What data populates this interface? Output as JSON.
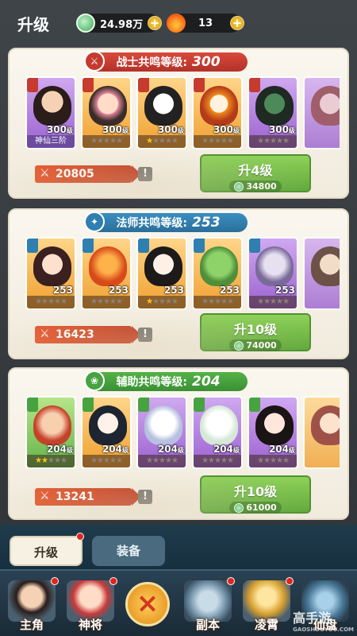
{
  "header": {
    "title": "升级"
  },
  "resources": {
    "coins": "24.98万",
    "fire": "13",
    "plus": "+"
  },
  "sections": [
    {
      "banner_label": "战士共鸣等级:",
      "banner_value": "300",
      "power": "20805",
      "button_label": "升4级",
      "button_cost": "34800",
      "cards": [
        {
          "level": "300",
          "unit": "级",
          "stars": 0,
          "name": "神仙三阶"
        },
        {
          "level": "300",
          "unit": "级",
          "stars": 0
        },
        {
          "level": "300",
          "unit": "级",
          "stars": 1
        },
        {
          "level": "300",
          "unit": "级",
          "stars": 0
        },
        {
          "level": "300",
          "unit": "级",
          "stars": 0
        }
      ]
    },
    {
      "banner_label": "法师共鸣等级:",
      "banner_value": "253",
      "power": "16423",
      "button_label": "升10级",
      "button_cost": "74000",
      "cards": [
        {
          "level": "253",
          "unit": "",
          "stars": 0
        },
        {
          "level": "253",
          "unit": "",
          "stars": 0
        },
        {
          "level": "253",
          "unit": "",
          "stars": 1
        },
        {
          "level": "253",
          "unit": "",
          "stars": 0
        },
        {
          "level": "253",
          "unit": "",
          "stars": 0
        }
      ]
    },
    {
      "banner_label": "辅助共鸣等级:",
      "banner_value": "204",
      "power": "13241",
      "button_label": "升10级",
      "button_cost": "61000",
      "cards": [
        {
          "level": "204",
          "unit": "级",
          "stars": 2
        },
        {
          "level": "204",
          "unit": "级",
          "stars": 0
        },
        {
          "level": "204",
          "unit": "级",
          "stars": 0
        },
        {
          "level": "204",
          "unit": "级",
          "stars": 0
        },
        {
          "level": "204",
          "unit": "级",
          "stars": 0
        }
      ]
    }
  ],
  "tabs": {
    "upgrade": "升级",
    "equip": "装备"
  },
  "nav": {
    "hero": "主角",
    "general": "神将",
    "close": "×",
    "dungeon": "副本",
    "lingxiao": "凌霄",
    "xianpan": "仙盘"
  },
  "watermark": {
    "main": "高手游",
    "sub": "GAOSHOUYOU.COM"
  },
  "colors": {
    "warrior": "#c53a30",
    "mage": "#2f7fb0",
    "support": "#47a240",
    "button": "#6fb844"
  }
}
